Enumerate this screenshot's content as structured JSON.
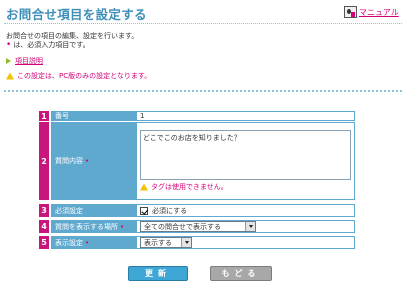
{
  "header": {
    "title": "お問合せ項目を設定する",
    "manual_label": "マニュアル"
  },
  "intro": {
    "line1": "お問合せの項目の編集、設定を行います。",
    "required_note": "は、必須入力項目です。",
    "required_mark": "•",
    "help_link": "項目説明",
    "pc_only_note": "この設定は、PC版のみの設定となります。"
  },
  "form": {
    "rows": [
      {
        "num": "1",
        "label": "番号",
        "required": false,
        "value": "1"
      },
      {
        "num": "2",
        "label": "質問内容",
        "required": true,
        "value": "どこでこのお店を知りました？",
        "note": "タグは使用できません。"
      },
      {
        "num": "3",
        "label": "必須設定",
        "required": false,
        "checkbox_label": "必須にする",
        "checked": true
      },
      {
        "num": "4",
        "label": "質問を表示する場所",
        "required": true,
        "selected": "全ての問合せで表示する"
      },
      {
        "num": "5",
        "label": "表示設定",
        "required": true,
        "selected": "表示する"
      }
    ],
    "required_mark": "•"
  },
  "buttons": {
    "update": "更新",
    "back": "もどる"
  }
}
